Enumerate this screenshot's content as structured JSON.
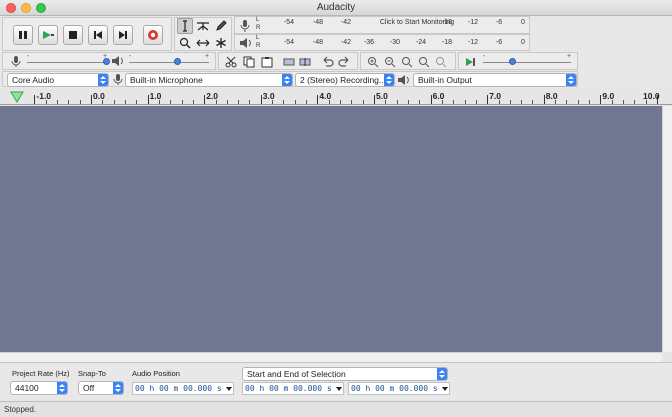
{
  "window": {
    "title": "Audacity"
  },
  "transport": {
    "buttons": [
      {
        "name": "pause-button",
        "icon": "pause-icon"
      },
      {
        "name": "play-button",
        "icon": "play-icon"
      },
      {
        "name": "stop-button",
        "icon": "stop-icon"
      },
      {
        "name": "skip-to-start-button",
        "icon": "skip-start-icon"
      },
      {
        "name": "skip-to-end-button",
        "icon": "skip-end-icon"
      },
      {
        "name": "record-button",
        "icon": "record-icon"
      }
    ]
  },
  "tools": [
    "selection-tool",
    "envelope-tool",
    "draw-tool",
    "zoom-tool",
    "time-shift-tool",
    "multi-tool"
  ],
  "meters": {
    "record": {
      "channels": [
        "L",
        "R"
      ],
      "scale": [
        "-54",
        "-48",
        "-42",
        "-18",
        "-12",
        "-6",
        "0"
      ],
      "prompt": "Click to Start Monitoring"
    },
    "playback": {
      "channels": [
        "L",
        "R"
      ],
      "scale": [
        "-54",
        "-48",
        "-42",
        "-36",
        "-30",
        "-24",
        "-18",
        "-12",
        "-6",
        "0"
      ]
    }
  },
  "mixer": {
    "recording_volume": 1.0,
    "playback_volume": 0.55,
    "minus": "-",
    "plus": "+"
  },
  "device": {
    "host": "Core Audio",
    "input": "Built-in Microphone",
    "channels": "2 (Stereo) Recording...",
    "output": "Built-in Output"
  },
  "play_at_speed": {
    "value": 0.5,
    "minus": "-",
    "plus": "+"
  },
  "timeline": {
    "labels": [
      "-1.0",
      "0.0",
      "1.0",
      "2.0",
      "3.0",
      "4.0",
      "5.0",
      "6.0",
      "7.0",
      "8.0",
      "9.0",
      "10.0"
    ],
    "values": [
      -1,
      0,
      1,
      2,
      3,
      4,
      5,
      6,
      7,
      8,
      9,
      10
    ]
  },
  "colors": {
    "track_background": "#717791",
    "accent": "#3b82f6",
    "record_red": "#d93a2b",
    "play_green": "#2fa548"
  },
  "selection_toolbar": {
    "project_rate_label": "Project Rate (Hz)",
    "project_rate_value": "44100",
    "snap_to_label": "Snap-To",
    "snap_to_value": "Off",
    "audio_position_label": "Audio Position",
    "audio_position_value": "00 h 00 m 00.000 s",
    "selection_mode": "Start and End of Selection",
    "selection_start": "00 h 00 m 00.000 s",
    "selection_end": "00 h 00 m 00.000 s"
  },
  "status": {
    "text": "Stopped."
  }
}
